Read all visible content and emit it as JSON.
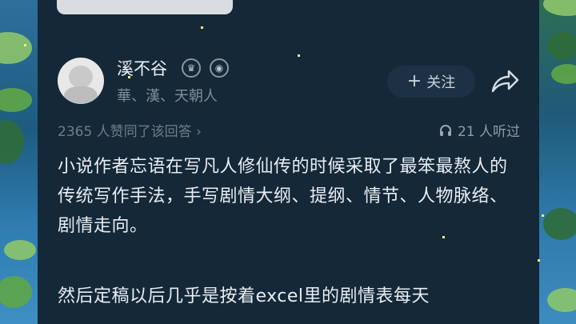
{
  "author": {
    "name": "溪不谷",
    "bio": "華、漢、天朝人"
  },
  "actions": {
    "follow_label": "关注",
    "follow_icon": "plus-icon",
    "share_icon": "share-icon"
  },
  "stats": {
    "likes_text": "2365 人赞同了该回答",
    "chevron": "›",
    "listen_text": "21 人听过",
    "listen_icon": "headphones-icon"
  },
  "content": {
    "paragraph1": "小说作者忘语在写凡人修仙传的时候采取了最笨最熬人的传统写作手法，手写剧情大纲、提纲、情节、人物脉络、剧情走向。",
    "paragraph2": "然后定稿以后几乎是按着excel里的剧情表每天"
  },
  "colors": {
    "panel": "#142838",
    "text": "#e9eef2",
    "muted": "#7f8d99"
  }
}
